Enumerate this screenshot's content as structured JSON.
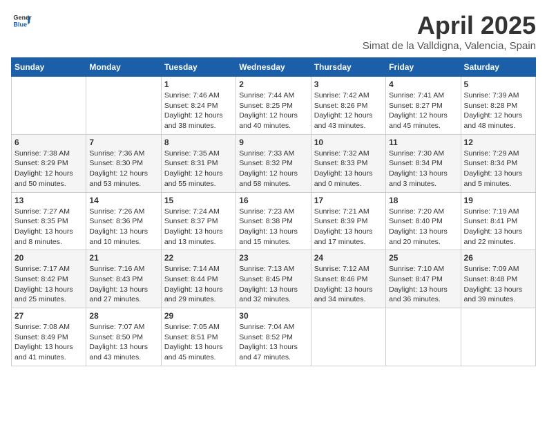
{
  "logo": {
    "line1": "General",
    "line2": "Blue"
  },
  "title": "April 2025",
  "location": "Simat de la Valldigna, Valencia, Spain",
  "weekdays": [
    "Sunday",
    "Monday",
    "Tuesday",
    "Wednesday",
    "Thursday",
    "Friday",
    "Saturday"
  ],
  "weeks": [
    [
      {
        "day": "",
        "info": ""
      },
      {
        "day": "",
        "info": ""
      },
      {
        "day": "1",
        "info": "Sunrise: 7:46 AM\nSunset: 8:24 PM\nDaylight: 12 hours and 38 minutes."
      },
      {
        "day": "2",
        "info": "Sunrise: 7:44 AM\nSunset: 8:25 PM\nDaylight: 12 hours and 40 minutes."
      },
      {
        "day": "3",
        "info": "Sunrise: 7:42 AM\nSunset: 8:26 PM\nDaylight: 12 hours and 43 minutes."
      },
      {
        "day": "4",
        "info": "Sunrise: 7:41 AM\nSunset: 8:27 PM\nDaylight: 12 hours and 45 minutes."
      },
      {
        "day": "5",
        "info": "Sunrise: 7:39 AM\nSunset: 8:28 PM\nDaylight: 12 hours and 48 minutes."
      }
    ],
    [
      {
        "day": "6",
        "info": "Sunrise: 7:38 AM\nSunset: 8:29 PM\nDaylight: 12 hours and 50 minutes."
      },
      {
        "day": "7",
        "info": "Sunrise: 7:36 AM\nSunset: 8:30 PM\nDaylight: 12 hours and 53 minutes."
      },
      {
        "day": "8",
        "info": "Sunrise: 7:35 AM\nSunset: 8:31 PM\nDaylight: 12 hours and 55 minutes."
      },
      {
        "day": "9",
        "info": "Sunrise: 7:33 AM\nSunset: 8:32 PM\nDaylight: 12 hours and 58 minutes."
      },
      {
        "day": "10",
        "info": "Sunrise: 7:32 AM\nSunset: 8:33 PM\nDaylight: 13 hours and 0 minutes."
      },
      {
        "day": "11",
        "info": "Sunrise: 7:30 AM\nSunset: 8:34 PM\nDaylight: 13 hours and 3 minutes."
      },
      {
        "day": "12",
        "info": "Sunrise: 7:29 AM\nSunset: 8:34 PM\nDaylight: 13 hours and 5 minutes."
      }
    ],
    [
      {
        "day": "13",
        "info": "Sunrise: 7:27 AM\nSunset: 8:35 PM\nDaylight: 13 hours and 8 minutes."
      },
      {
        "day": "14",
        "info": "Sunrise: 7:26 AM\nSunset: 8:36 PM\nDaylight: 13 hours and 10 minutes."
      },
      {
        "day": "15",
        "info": "Sunrise: 7:24 AM\nSunset: 8:37 PM\nDaylight: 13 hours and 13 minutes."
      },
      {
        "day": "16",
        "info": "Sunrise: 7:23 AM\nSunset: 8:38 PM\nDaylight: 13 hours and 15 minutes."
      },
      {
        "day": "17",
        "info": "Sunrise: 7:21 AM\nSunset: 8:39 PM\nDaylight: 13 hours and 17 minutes."
      },
      {
        "day": "18",
        "info": "Sunrise: 7:20 AM\nSunset: 8:40 PM\nDaylight: 13 hours and 20 minutes."
      },
      {
        "day": "19",
        "info": "Sunrise: 7:19 AM\nSunset: 8:41 PM\nDaylight: 13 hours and 22 minutes."
      }
    ],
    [
      {
        "day": "20",
        "info": "Sunrise: 7:17 AM\nSunset: 8:42 PM\nDaylight: 13 hours and 25 minutes."
      },
      {
        "day": "21",
        "info": "Sunrise: 7:16 AM\nSunset: 8:43 PM\nDaylight: 13 hours and 27 minutes."
      },
      {
        "day": "22",
        "info": "Sunrise: 7:14 AM\nSunset: 8:44 PM\nDaylight: 13 hours and 29 minutes."
      },
      {
        "day": "23",
        "info": "Sunrise: 7:13 AM\nSunset: 8:45 PM\nDaylight: 13 hours and 32 minutes."
      },
      {
        "day": "24",
        "info": "Sunrise: 7:12 AM\nSunset: 8:46 PM\nDaylight: 13 hours and 34 minutes."
      },
      {
        "day": "25",
        "info": "Sunrise: 7:10 AM\nSunset: 8:47 PM\nDaylight: 13 hours and 36 minutes."
      },
      {
        "day": "26",
        "info": "Sunrise: 7:09 AM\nSunset: 8:48 PM\nDaylight: 13 hours and 39 minutes."
      }
    ],
    [
      {
        "day": "27",
        "info": "Sunrise: 7:08 AM\nSunset: 8:49 PM\nDaylight: 13 hours and 41 minutes."
      },
      {
        "day": "28",
        "info": "Sunrise: 7:07 AM\nSunset: 8:50 PM\nDaylight: 13 hours and 43 minutes."
      },
      {
        "day": "29",
        "info": "Sunrise: 7:05 AM\nSunset: 8:51 PM\nDaylight: 13 hours and 45 minutes."
      },
      {
        "day": "30",
        "info": "Sunrise: 7:04 AM\nSunset: 8:52 PM\nDaylight: 13 hours and 47 minutes."
      },
      {
        "day": "",
        "info": ""
      },
      {
        "day": "",
        "info": ""
      },
      {
        "day": "",
        "info": ""
      }
    ]
  ]
}
